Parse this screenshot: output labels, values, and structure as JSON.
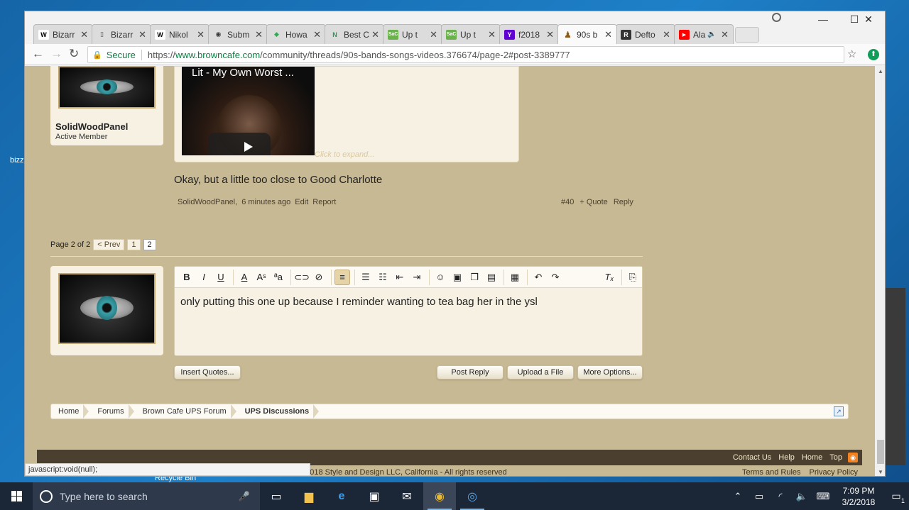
{
  "desktop": {
    "icon_label_1": "bizz",
    "icon_label_2": "Recycle Bin"
  },
  "browser": {
    "tabs": [
      {
        "favicon": "W",
        "label": "Bizarr"
      },
      {
        "favicon": "▯",
        "label": "Bizarr"
      },
      {
        "favicon": "W",
        "label": "Nikol"
      },
      {
        "favicon": "◉",
        "label": "Subm"
      },
      {
        "favicon": "◆",
        "label": "Howa"
      },
      {
        "favicon": "N",
        "label": "Best C"
      },
      {
        "favicon": "SaC",
        "label": "Up t"
      },
      {
        "favicon": "SaC",
        "label": "Up t"
      },
      {
        "favicon": "Y",
        "label": "f2018"
      },
      {
        "favicon": "♟",
        "label": "90s b"
      },
      {
        "favicon": "R",
        "label": "Defto"
      },
      {
        "favicon": "▶",
        "label": "Ala"
      }
    ],
    "secure_label": "Secure",
    "url_scheme": "https://",
    "url_host": "www.browncafe.com",
    "url_path": "/community/threads/90s-bands-songs-videos.376674/page-2#post-3389777"
  },
  "post": {
    "username": "SolidWoodPanel",
    "user_title": "Active Member",
    "video_title": "Lit - My Own Worst ...",
    "click_expand": "Click to expand...",
    "body": "Okay, but a little too close to Good Charlotte",
    "meta_author": "SolidWoodPanel,",
    "meta_time": "6 minutes ago",
    "edit": "Edit",
    "report": "Report",
    "number": "#40",
    "quote": "+ Quote",
    "reply": "Reply"
  },
  "pagination": {
    "label": "Page 2 of 2",
    "prev": "< Prev",
    "p1": "1",
    "p2": "2"
  },
  "editor": {
    "text": "only putting this one up because I reminder wanting to tea bag her in the ysl",
    "insert_quotes": "Insert Quotes...",
    "post_reply": "Post Reply",
    "upload": "Upload a File",
    "more_options": "More Options..."
  },
  "breadcrumb": {
    "home": "Home",
    "forums": "Forums",
    "forum": "Brown Cafe UPS Forum",
    "current": "UPS Discussions"
  },
  "footer": {
    "contact": "Contact Us",
    "help": "Help",
    "home": "Home",
    "top": "Top",
    "copyright": "Forum software by XenForo™ ©2010-2017 XenForo Ltd. | Copyright ©1999-2018 Style and Design LLC, California - All rights reserved",
    "terms": "Terms and Rules",
    "privacy": "Privacy Policy",
    "status_url": "javascript:void(null);"
  },
  "taskbar": {
    "search_placeholder": "Type here to search",
    "time": "7:09 PM",
    "date": "3/2/2018",
    "notification_count": "1"
  }
}
